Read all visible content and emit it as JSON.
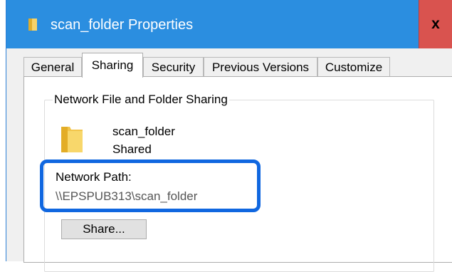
{
  "window": {
    "title": "scan_folder Properties",
    "close_label": "x"
  },
  "tabs": [
    {
      "label": "General"
    },
    {
      "label": "Sharing"
    },
    {
      "label": "Security"
    },
    {
      "label": "Previous Versions"
    },
    {
      "label": "Customize"
    }
  ],
  "active_tab": "Sharing",
  "sharing": {
    "group_title": "Network File and Folder Sharing",
    "folder_name": "scan_folder",
    "folder_status": "Shared",
    "network_path_label": "Network Path:",
    "network_path_value": "\\\\EPSPUB313\\scan_folder",
    "share_button_label": "Share..."
  },
  "colors": {
    "titlebar": "#2b8ee0",
    "close_button": "#d9534f",
    "highlight_border": "#1067e0",
    "folder_icon": "#f2c44a"
  },
  "icons": {
    "title": "folder-icon",
    "folder": "folder-icon"
  }
}
